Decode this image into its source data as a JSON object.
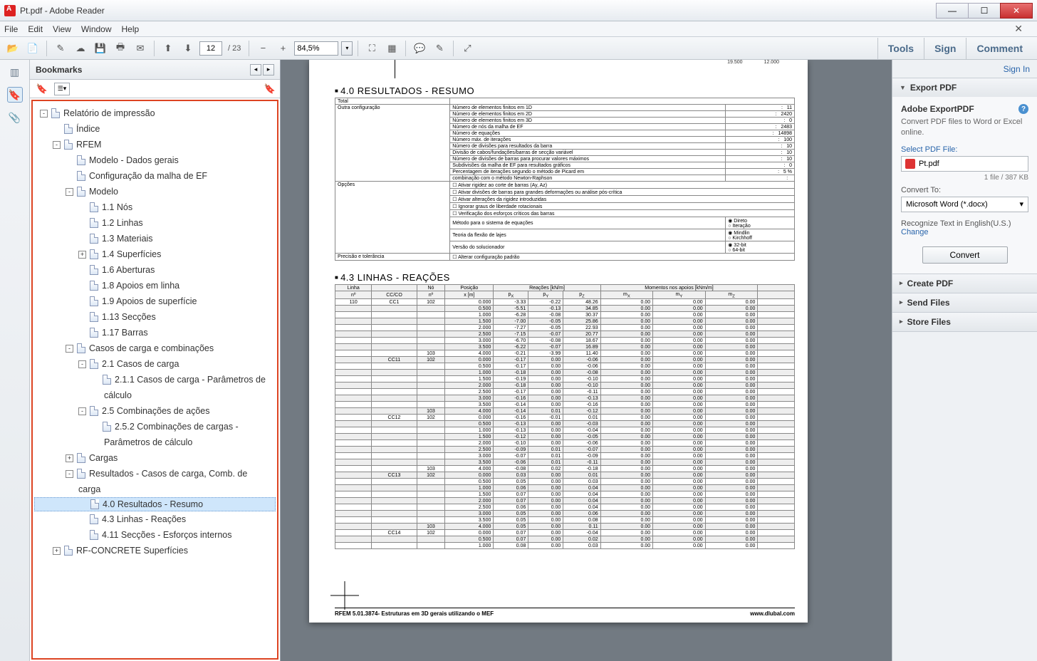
{
  "window": {
    "title": "Pt.pdf - Adobe Reader"
  },
  "menu": {
    "file": "File",
    "edit": "Edit",
    "view": "View",
    "window": "Window",
    "help": "Help"
  },
  "toolbar": {
    "page": "12",
    "total": "/ 23",
    "zoom": "84,5%",
    "tools": "Tools",
    "sign": "Sign",
    "comment": "Comment"
  },
  "bookmarks": {
    "title": "Bookmarks",
    "tree": [
      {
        "lvl": 0,
        "tw": "-",
        "label": "Relatório de impressão"
      },
      {
        "lvl": 1,
        "label": "Índice"
      },
      {
        "lvl": 1,
        "tw": "-",
        "label": "RFEM"
      },
      {
        "lvl": 2,
        "label": "Modelo - Dados gerais"
      },
      {
        "lvl": 2,
        "label": "Configuração da malha de EF"
      },
      {
        "lvl": 2,
        "tw": "-",
        "label": "Modelo"
      },
      {
        "lvl": 3,
        "label": "1.1 Nós"
      },
      {
        "lvl": 3,
        "label": "1.2 Linhas"
      },
      {
        "lvl": 3,
        "label": "1.3 Materiais"
      },
      {
        "lvl": 3,
        "tw": "+",
        "label": "1.4 Superfícies"
      },
      {
        "lvl": 3,
        "label": "1.6 Aberturas"
      },
      {
        "lvl": 3,
        "label": "1.8 Apoios em linha"
      },
      {
        "lvl": 3,
        "label": "1.9 Apoios de superfície"
      },
      {
        "lvl": 3,
        "label": "1.13 Secções"
      },
      {
        "lvl": 3,
        "label": "1.17 Barras"
      },
      {
        "lvl": 2,
        "tw": "-",
        "label": "Casos de carga e combinações"
      },
      {
        "lvl": 3,
        "tw": "-",
        "label": "2.1 Casos de carga"
      },
      {
        "lvl": 4,
        "label": "2.1.1 Casos de carga - Parâmetros de"
      },
      {
        "lvl": 4,
        "cont": true,
        "label": "cálculo"
      },
      {
        "lvl": 3,
        "tw": "-",
        "label": "2.5 Combinações de ações"
      },
      {
        "lvl": 4,
        "label": "2.5.2 Combinações de cargas -"
      },
      {
        "lvl": 4,
        "cont": true,
        "label": "Parâmetros de cálculo"
      },
      {
        "lvl": 2,
        "tw": "+",
        "label": "Cargas"
      },
      {
        "lvl": 2,
        "tw": "-",
        "label": "Resultados - Casos de carga, Comb. de"
      },
      {
        "lvl": 2,
        "cont": true,
        "label": "carga"
      },
      {
        "lvl": 3,
        "sel": true,
        "label": "4.0 Resultados - Resumo"
      },
      {
        "lvl": 3,
        "label": "4.3 Linhas - Reações"
      },
      {
        "lvl": 3,
        "label": "4.11 Secções - Esforços internos"
      },
      {
        "lvl": 1,
        "tw": "+",
        "label": "RF-CONCRETE Superfícies"
      }
    ]
  },
  "doc": {
    "ruler": [
      "19.500",
      "12.000"
    ],
    "sec1": "4.0 RESULTADOS - RESUMO",
    "resumoHdr": {
      "c1": "Total",
      "c2": ""
    },
    "resumoRow": "Outra configuração",
    "resumoLines": [
      [
        "Número de elementos finitos em 1D",
        "11"
      ],
      [
        "Número de elementos finitos em 2D",
        "2420"
      ],
      [
        "Número de elementos finitos em 3D",
        "0"
      ],
      [
        "Número de nós da malha de EF",
        "2483"
      ],
      [
        "Número de equações",
        "14898"
      ],
      [
        "Número máx. de iterações",
        "100"
      ],
      [
        "Número de divisões para resultados da barra",
        "10"
      ],
      [
        "Divisão de cabos/fundações/barras de secção variável",
        "10"
      ],
      [
        "Número de divisões de barras para procurar valores máximos",
        "10"
      ],
      [
        "Subdivisões da malha de EF para resultados gráficos",
        "0"
      ],
      [
        "Percentagem de iterações segundo o método de Picard em",
        "5 %"
      ],
      [
        "combinação com o método Newton-Raphson",
        ""
      ]
    ],
    "opcoesLbl": "Opções",
    "opcoes": [
      "Ativar rigidez ao corte de barras (Ay, Az)",
      "Ativar divisões de barras para grandes deformações ou análise pós-crítica",
      "Ativar alterações da rigidez introduzidas",
      "Ignorar graus de liberdade rotacionais",
      "Verificação dos esforços críticos das barras"
    ],
    "metodo": "Método para o sistema de equações",
    "metodoOpts": [
      "Direto",
      "Iteração"
    ],
    "flexao": "Teoria da flexão de lajes",
    "flexaoOpts": [
      "Mindlin",
      "Kirchhoff"
    ],
    "versao": "Versão do solucionador",
    "versaoOpts": [
      "32-bit",
      "64-bit"
    ],
    "precisao": "Precisão e tolerância",
    "precisaoOpt": "Alterar configuração padrão",
    "sec2": "4.3 LINHAS - REAÇÕES",
    "t2head1": [
      "Linha",
      "Nó",
      "Posição",
      "Reações [kN/m]",
      "Momentos nos apoios [kNm/m]",
      ""
    ],
    "t2head2": [
      "nº",
      "CC/CO",
      "nº",
      "x [m]",
      "p<sub>X</sub>",
      "p<sub>Y</sub>",
      "p<sub>Z</sub>",
      "m<sub>X</sub>",
      "m<sub>Y</sub>",
      "m<sub>Z</sub>",
      ""
    ],
    "rows": [
      [
        "110",
        "CC1",
        "102",
        "0.000",
        "-3.33",
        "-0.22",
        "48.26",
        "0.00",
        "0.00",
        "0.00"
      ],
      [
        "",
        "",
        "",
        "0.500",
        "-5.51",
        "-0.13",
        "34.85",
        "0.00",
        "0.00",
        "0.00"
      ],
      [
        "",
        "",
        "",
        "1.000",
        "-6.28",
        "-0.08",
        "30.37",
        "0.00",
        "0.00",
        "0.00"
      ],
      [
        "",
        "",
        "",
        "1.500",
        "-7.00",
        "-0.05",
        "25.86",
        "0.00",
        "0.00",
        "0.00"
      ],
      [
        "",
        "",
        "",
        "2.000",
        "-7.27",
        "-0.05",
        "22.93",
        "0.00",
        "0.00",
        "0.00"
      ],
      [
        "",
        "",
        "",
        "2.500",
        "-7.15",
        "-0.07",
        "20.77",
        "0.00",
        "0.00",
        "0.00"
      ],
      [
        "",
        "",
        "",
        "3.000",
        "-6.70",
        "-0.08",
        "18.67",
        "0.00",
        "0.00",
        "0.00"
      ],
      [
        "",
        "",
        "",
        "3.500",
        "-6.22",
        "-0.07",
        "16.89",
        "0.00",
        "0.00",
        "0.00"
      ],
      [
        "",
        "",
        "103",
        "4.000",
        "-0.21",
        "-3.99",
        "11.40",
        "0.00",
        "0.00",
        "0.00"
      ],
      [
        "",
        "CC11",
        "102",
        "0.000",
        "-0.17",
        "0.00",
        "-0.06",
        "0.00",
        "0.00",
        "0.00"
      ],
      [
        "",
        "",
        "",
        "0.500",
        "-0.17",
        "0.00",
        "-0.06",
        "0.00",
        "0.00",
        "0.00"
      ],
      [
        "",
        "",
        "",
        "1.000",
        "-0.18",
        "0.00",
        "-0.08",
        "0.00",
        "0.00",
        "0.00"
      ],
      [
        "",
        "",
        "",
        "1.500",
        "-0.19",
        "0.00",
        "-0.10",
        "0.00",
        "0.00",
        "0.00"
      ],
      [
        "",
        "",
        "",
        "2.000",
        "-0.18",
        "0.00",
        "-0.10",
        "0.00",
        "0.00",
        "0.00"
      ],
      [
        "",
        "",
        "",
        "2.500",
        "-0.17",
        "0.00",
        "-0.11",
        "0.00",
        "0.00",
        "0.00"
      ],
      [
        "",
        "",
        "",
        "3.000",
        "-0.16",
        "0.00",
        "-0.13",
        "0.00",
        "0.00",
        "0.00"
      ],
      [
        "",
        "",
        "",
        "3.500",
        "-0.14",
        "0.00",
        "-0.16",
        "0.00",
        "0.00",
        "0.00"
      ],
      [
        "",
        "",
        "103",
        "4.000",
        "-0.14",
        "0.01",
        "-0.12",
        "0.00",
        "0.00",
        "0.00"
      ],
      [
        "",
        "CC12",
        "102",
        "0.000",
        "-0.16",
        "-0.01",
        "0.01",
        "0.00",
        "0.00",
        "0.00"
      ],
      [
        "",
        "",
        "",
        "0.500",
        "-0.13",
        "0.00",
        "-0.03",
        "0.00",
        "0.00",
        "0.00"
      ],
      [
        "",
        "",
        "",
        "1.000",
        "-0.13",
        "0.00",
        "-0.04",
        "0.00",
        "0.00",
        "0.00"
      ],
      [
        "",
        "",
        "",
        "1.500",
        "-0.12",
        "0.00",
        "-0.05",
        "0.00",
        "0.00",
        "0.00"
      ],
      [
        "",
        "",
        "",
        "2.000",
        "-0.10",
        "0.00",
        "-0.06",
        "0.00",
        "0.00",
        "0.00"
      ],
      [
        "",
        "",
        "",
        "2.500",
        "-0.09",
        "0.01",
        "-0.07",
        "0.00",
        "0.00",
        "0.00"
      ],
      [
        "",
        "",
        "",
        "3.000",
        "-0.07",
        "0.01",
        "-0.09",
        "0.00",
        "0.00",
        "0.00"
      ],
      [
        "",
        "",
        "",
        "3.500",
        "-0.06",
        "0.01",
        "-0.11",
        "0.00",
        "0.00",
        "0.00"
      ],
      [
        "",
        "",
        "103",
        "4.000",
        "-0.08",
        "0.02",
        "-0.18",
        "0.00",
        "0.00",
        "0.00"
      ],
      [
        "",
        "CC13",
        "102",
        "0.000",
        "0.03",
        "0.00",
        "0.01",
        "0.00",
        "0.00",
        "0.00"
      ],
      [
        "",
        "",
        "",
        "0.500",
        "0.05",
        "0.00",
        "0.03",
        "0.00",
        "0.00",
        "0.00"
      ],
      [
        "",
        "",
        "",
        "1.000",
        "0.06",
        "0.00",
        "0.04",
        "0.00",
        "0.00",
        "0.00"
      ],
      [
        "",
        "",
        "",
        "1.500",
        "0.07",
        "0.00",
        "0.04",
        "0.00",
        "0.00",
        "0.00"
      ],
      [
        "",
        "",
        "",
        "2.000",
        "0.07",
        "0.00",
        "0.04",
        "0.00",
        "0.00",
        "0.00"
      ],
      [
        "",
        "",
        "",
        "2.500",
        "0.06",
        "0.00",
        "0.04",
        "0.00",
        "0.00",
        "0.00"
      ],
      [
        "",
        "",
        "",
        "3.000",
        "0.05",
        "0.00",
        "0.06",
        "0.00",
        "0.00",
        "0.00"
      ],
      [
        "",
        "",
        "",
        "3.500",
        "0.05",
        "0.00",
        "0.08",
        "0.00",
        "0.00",
        "0.00"
      ],
      [
        "",
        "",
        "103",
        "4.000",
        "0.05",
        "0.00",
        "0.11",
        "0.00",
        "0.00",
        "0.00"
      ],
      [
        "",
        "CC14",
        "102",
        "0.000",
        "0.07",
        "0.00",
        "-0.04",
        "0.00",
        "0.00",
        "0.00"
      ],
      [
        "",
        "",
        "",
        "0.500",
        "0.07",
        "0.00",
        "0.02",
        "0.00",
        "0.00",
        "0.00"
      ],
      [
        "",
        "",
        "",
        "1.000",
        "0.08",
        "0.00",
        "0.03",
        "0.00",
        "0.00",
        "0.00"
      ]
    ],
    "footerL": "RFEM 5.01.3874- Estruturas em 3D gerais utilizando o MEF",
    "footerR": "www.dlubal.com"
  },
  "right": {
    "signin": "Sign In",
    "export": "Export PDF",
    "exportH": "Adobe ExportPDF",
    "exportSub": "Convert PDF files to Word or Excel online.",
    "selLbl": "Select PDF File:",
    "file": "Pt.pdf",
    "fileinfo": "1 file / 387 KB",
    "convLbl": "Convert To:",
    "convSel": "Microsoft Word (*.docx)",
    "recog": "Recognize Text in English(U.S.)",
    "change": "Change",
    "convertBtn": "Convert",
    "create": "Create PDF",
    "send": "Send Files",
    "store": "Store Files"
  }
}
